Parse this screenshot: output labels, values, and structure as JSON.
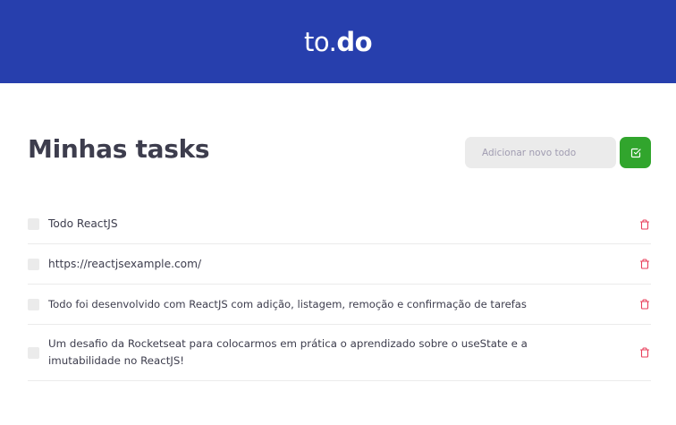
{
  "header": {
    "logo_light": "to.",
    "logo_bold": "do"
  },
  "main": {
    "title": "Minhas tasks",
    "add_input": {
      "placeholder": "Adicionar novo todo",
      "value": ""
    },
    "add_button_icon": "check-square-icon",
    "delete_icon": "trash-icon"
  },
  "tasks": [
    {
      "text": "Todo ReactJS",
      "completed": false
    },
    {
      "text": "https://reactjsexample.com/",
      "completed": false
    },
    {
      "text": "Todo foi desenvolvido com ReactJS com adição, listagem, remoção e confirmação de tarefas",
      "completed": false
    },
    {
      "text": "Um desafio da Rocketseat para colocarmos em prática o aprendizado sobre o useState e a imutabilidade no ReactJS!",
      "completed": false
    }
  ],
  "colors": {
    "header_bg": "#273fad",
    "add_button_bg": "#31a52d",
    "delete_icon": "#e83f5b",
    "input_bg": "#ebebeb",
    "text": "#3d3d4d"
  }
}
